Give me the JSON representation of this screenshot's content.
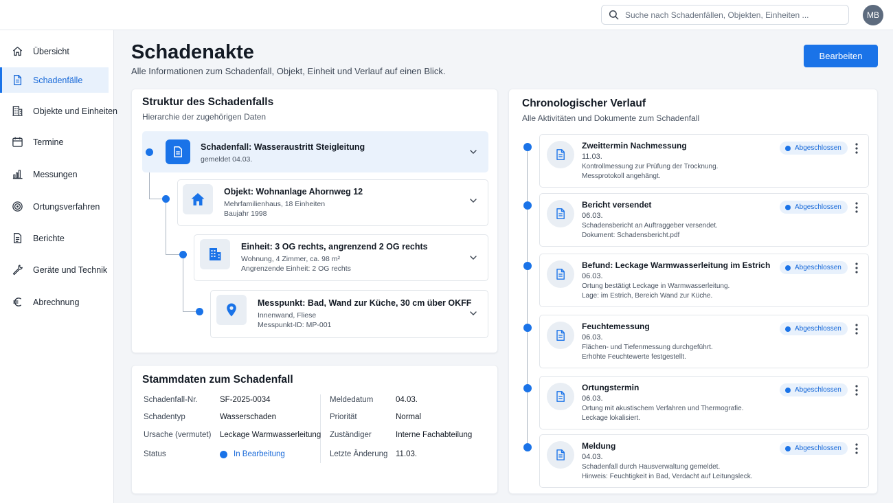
{
  "colors": {
    "accent": "#1a73e8",
    "accent_light": "#e8f1fc",
    "text": "#131a24",
    "muted": "#4a5462"
  },
  "header": {
    "search_placeholder": "Suche nach Schadenfällen, Objekten, Einheiten ...",
    "avatar_initials": "MB"
  },
  "sidebar": {
    "items": [
      {
        "label": "Übersicht",
        "icon": "home-icon"
      },
      {
        "label": "Schadenfälle",
        "icon": "document-icon",
        "active": true
      },
      {
        "label": "Objekte und Einheiten",
        "icon": "building-icon"
      },
      {
        "label": "Termine",
        "icon": "calendar-icon"
      },
      {
        "label": "Messungen",
        "icon": "bar-chart-icon"
      },
      {
        "label": "Ortungsverfahren",
        "icon": "target-icon"
      },
      {
        "label": "Berichte",
        "icon": "report-icon"
      },
      {
        "label": "Geräte und Technik",
        "icon": "wrench-icon"
      },
      {
        "label": "Abrechnung",
        "icon": "euro-icon"
      }
    ]
  },
  "page": {
    "title": "Schadenakte",
    "subtitle": "Alle Informationen zum Schadenfall, Objekt, Einheit und Verlauf auf einen Blick.",
    "edit_label": "Bearbeiten"
  },
  "structure": {
    "title": "Struktur des Schadenfalls",
    "subtitle": "Hierarchie der zugehörigen Daten",
    "nodes": [
      {
        "title": "Schadenfall: Wasseraustritt Steigleitung",
        "line1": "gemeldet 04.03.",
        "line2": "",
        "icon": "document-icon"
      },
      {
        "title": "Objekt: Wohnanlage Ahornweg 12",
        "line1": "Mehrfamilienhaus, 18 Einheiten",
        "line2": "Baujahr 1998",
        "icon": "house-icon"
      },
      {
        "title": "Einheit: 3 OG rechts, angrenzend 2 OG rechts",
        "line1": "Wohnung, 4 Zimmer, ca. 98 m²",
        "line2": "Angrenzende Einheit: 2 OG rechts",
        "icon": "building-icon"
      },
      {
        "title": "Messpunkt: Bad, Wand zur Küche, 30 cm über OKFF",
        "line1": "Innenwand, Fliese",
        "line2": "Messpunkt-ID: MP-001",
        "icon": "location-pin-icon"
      }
    ]
  },
  "stammdaten": {
    "title": "Stammdaten zum Schadenfall",
    "left": [
      {
        "label": "Schadenfall-Nr.",
        "value": "SF-2025-0034"
      },
      {
        "label": "Schadentyp",
        "value": "Wasserschaden"
      },
      {
        "label": "Ursache (vermutet)",
        "value": "Leckage Warmwasserleitung"
      },
      {
        "label": "Status",
        "value": "In Bearbeitung"
      }
    ],
    "right": [
      {
        "label": "Meldedatum",
        "value": "04.03."
      },
      {
        "label": "Priorität",
        "value": "Normal"
      },
      {
        "label": "Zuständiger",
        "value": "Interne Fachabteilung"
      },
      {
        "label": "Letzte Änderung",
        "value": "11.03."
      }
    ]
  },
  "timeline": {
    "title": "Chronologischer Verlauf",
    "subtitle": "Alle Aktivitäten und Dokumente zum Schadenfall",
    "events": [
      {
        "title": "Zweittermin Nachmessung",
        "date": "11.03.",
        "line1": "Kontrollmessung zur Prüfung der Trocknung.",
        "line2": "Messprotokoll angehängt.",
        "status": "Abgeschlossen"
      },
      {
        "title": "Bericht versendet",
        "date": "06.03.",
        "line1": "Schadensbericht an Auftraggeber versendet.",
        "line2": "Dokument: Schadensbericht.pdf",
        "status": "Abgeschlossen"
      },
      {
        "title": "Befund: Leckage Warmwasserleitung im Estrich",
        "date": "06.03.",
        "line1": "Ortung bestätigt Leckage in Warmwasserleitung.",
        "line2": "Lage: im Estrich, Bereich Wand zur Küche.",
        "status": "Abgeschlossen"
      },
      {
        "title": "Feuchtemessung",
        "date": "06.03.",
        "line1": "Flächen- und Tiefenmessung durchgeführt.",
        "line2": "Erhöhte Feuchtewerte festgestellt.",
        "status": "Abgeschlossen"
      },
      {
        "title": "Ortungstermin",
        "date": "06.03.",
        "line1": "Ortung mit akustischem Verfahren und Thermografie.",
        "line2": "Leckage lokalisiert.",
        "status": "Abgeschlossen"
      },
      {
        "title": "Meldung",
        "date": "04.03.",
        "line1": "Schadenfall durch Hausverwaltung gemeldet.",
        "line2": "Hinweis: Feuchtigkeit in Bad, Verdacht auf Leitungsleck.",
        "status": "Abgeschlossen"
      }
    ]
  }
}
